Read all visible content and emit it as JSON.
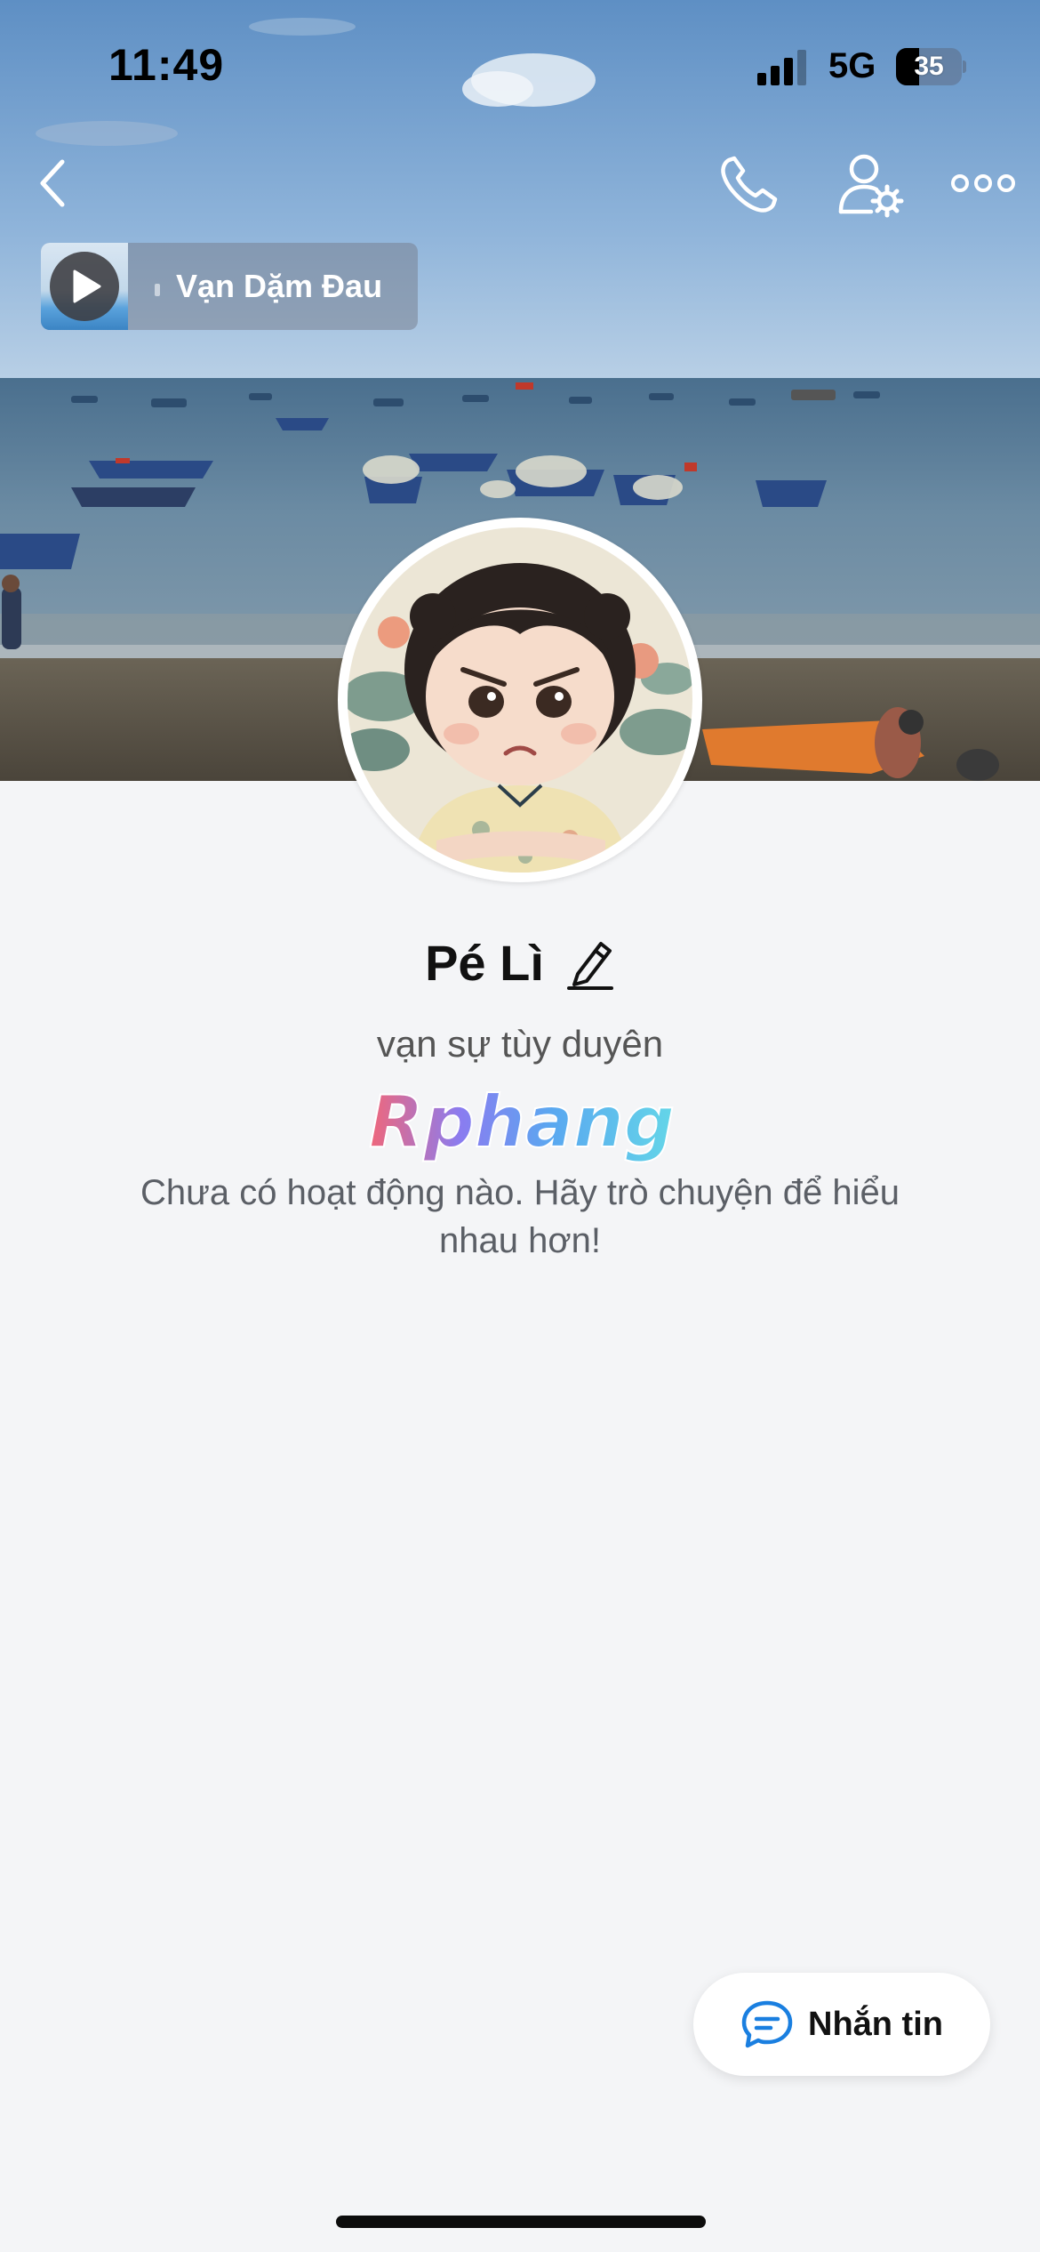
{
  "status_bar": {
    "time": "11:49",
    "network": "5G",
    "battery_percent": "35",
    "battery_level": 0.35,
    "signal_icon": "cellular-signal-icon"
  },
  "nav": {
    "back_icon": "chevron-left-icon",
    "call_icon": "phone-icon",
    "settings_icon": "user-gear-icon",
    "more_icon": "ellipsis-icon"
  },
  "music": {
    "title": "Vạn Dặm Đau",
    "play_icon": "play-icon"
  },
  "profile": {
    "name": "Pé Lì",
    "edit_icon": "pencil-icon",
    "bio": "vạn sự tùy duyên",
    "watermark": "Rphang",
    "empty_message": "Chưa có hoạt động nào. Hãy trò chuyện để hiểu nhau hơn!"
  },
  "actions": {
    "message_label": "Nhắn tin",
    "message_icon": "chat-bubble-icon"
  },
  "colors": {
    "background": "#f4f5f7",
    "accent": "#1a7fe0"
  }
}
